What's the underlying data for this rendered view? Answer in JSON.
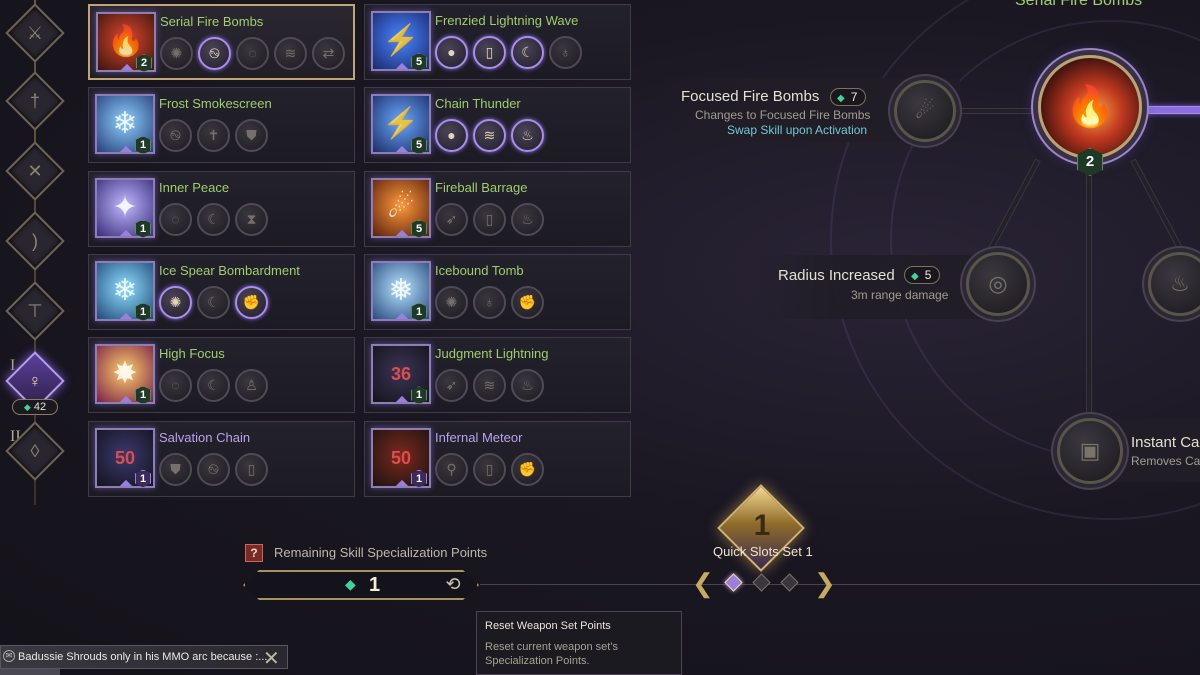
{
  "rail": {
    "roman_1": "I",
    "roman_2": "II",
    "points": "42",
    "nodes": [
      "sword-icon",
      "greatsword-icon",
      "crossed-swords-icon",
      "bow-icon",
      "crossbow-icon",
      "staff-icon",
      "wand-icon"
    ]
  },
  "skills": [
    {
      "name": "Serial Fire Bombs",
      "level": "2",
      "glyph": "🔥",
      "color_from": "#e0462c",
      "color_to": "#3a1610",
      "selected": true
    },
    {
      "name": "Frenzied Lightning Wave",
      "level": "5",
      "glyph": "⚡",
      "color_from": "#4a86ff",
      "color_to": "#1a2a70"
    },
    {
      "name": "Frost Smokescreen",
      "level": "1",
      "glyph": "❄",
      "color_from": "#8fd0ff",
      "color_to": "#263f7a"
    },
    {
      "name": "Chain Thunder",
      "level": "5",
      "glyph": "⚡",
      "color_from": "#6aa8ff",
      "color_to": "#1c2d66"
    },
    {
      "name": "Inner Peace",
      "level": "1",
      "glyph": "✦",
      "color_from": "#c0b8ff",
      "color_to": "#3a2d7a"
    },
    {
      "name": "Fireball Barrage",
      "level": "5",
      "glyph": "☄",
      "color_from": "#ff9a3a",
      "color_to": "#5a200e"
    },
    {
      "name": "Ice Spear Bombardment",
      "level": "1",
      "glyph": "❄",
      "color_from": "#8fe0ff",
      "color_to": "#204a7a"
    },
    {
      "name": "Icebound Tomb",
      "level": "1",
      "glyph": "❅",
      "color_from": "#b6e4ff",
      "color_to": "#2a4a80"
    },
    {
      "name": "High Focus",
      "level": "1",
      "glyph": "✸",
      "color_from": "#ffcf6a",
      "color_to": "#7a2048"
    },
    {
      "name": "Judgment Lightning",
      "level": "1",
      "glyph": "",
      "big_num": "36",
      "color_from": "#3a3556",
      "color_to": "#15131c"
    },
    {
      "name": "Salvation Chain",
      "level": "1",
      "glyph": "",
      "big_num": "50",
      "color_from": "#3a3a70",
      "color_to": "#15131c",
      "purple": true
    },
    {
      "name": "Infernal Meteor",
      "level": "1",
      "glyph": "",
      "big_num": "50",
      "color_from": "#7a2a1e",
      "color_to": "#1d1210",
      "purple": true
    }
  ],
  "modifiers": [
    [
      {
        "icon": "burst-icon",
        "on": false
      },
      {
        "icon": "swirl-icon",
        "on": true
      },
      {
        "icon": "ring-icon",
        "on": false
      },
      {
        "icon": "wave-icon",
        "on": false
      },
      {
        "icon": "swap-icon",
        "on": false
      }
    ],
    [
      {
        "icon": "bomb-icon",
        "on": true
      },
      {
        "icon": "scroll-icon",
        "on": true
      },
      {
        "icon": "crescent-icon",
        "on": true
      },
      {
        "icon": "pouch-icon",
        "on": false
      }
    ],
    [
      {
        "icon": "swirl-icon",
        "on": false
      },
      {
        "icon": "cross-icon",
        "on": false
      },
      {
        "icon": "shield-icon",
        "on": false
      }
    ],
    [
      {
        "icon": "bomb-icon",
        "on": true
      },
      {
        "icon": "wave-icon",
        "on": true
      },
      {
        "icon": "flame-icon",
        "on": true
      }
    ],
    [
      {
        "icon": "ring-icon",
        "on": false
      },
      {
        "icon": "crescent-icon",
        "on": false
      },
      {
        "icon": "timer-icon",
        "on": false
      }
    ],
    [
      {
        "icon": "arrow-icon",
        "on": false
      },
      {
        "icon": "scroll-icon",
        "on": false
      },
      {
        "icon": "flame-icon",
        "on": false
      }
    ],
    [
      {
        "icon": "burst-icon",
        "on": true
      },
      {
        "icon": "crescent-icon",
        "on": false
      },
      {
        "icon": "fist-icon",
        "on": true
      }
    ],
    [
      {
        "icon": "burst-icon",
        "on": false
      },
      {
        "icon": "pouch-icon",
        "on": false
      },
      {
        "icon": "fist-icon",
        "on": false
      }
    ],
    [
      {
        "icon": "ring-icon",
        "on": false
      },
      {
        "icon": "crescent-icon",
        "on": false
      },
      {
        "icon": "figure-icon",
        "on": false
      }
    ],
    [
      {
        "icon": "arrow-icon",
        "on": false
      },
      {
        "icon": "wave-icon",
        "on": false
      },
      {
        "icon": "flame-icon",
        "on": false
      }
    ],
    [
      {
        "icon": "shield-icon",
        "on": false
      },
      {
        "icon": "swirl-icon",
        "on": false
      },
      {
        "icon": "scroll-icon",
        "on": false
      }
    ],
    [
      {
        "icon": "pin-icon",
        "on": false
      },
      {
        "icon": "scroll-icon",
        "on": false
      },
      {
        "icon": "fist-icon",
        "on": false
      }
    ]
  ],
  "tree": {
    "title": "Serial Fire Bombs",
    "main_level": "2",
    "focused": {
      "name": "Focused Fire Bombs",
      "cost": "7",
      "desc": "Changes to Focused Fire Bombs",
      "highlight": "Swap Skill upon Activation"
    },
    "radius": {
      "name": "Radius Increased",
      "cost": "5",
      "desc": "3m range damage"
    },
    "instant": {
      "name": "Instant Ca",
      "desc": "Removes Ca"
    }
  },
  "bottom": {
    "help": "?",
    "remaining_label": "Remaining Skill Specialization Points",
    "remaining_points": "1",
    "reset_icon": "⟲",
    "quick_slot_number": "1",
    "quick_slot_label": "Quick Slots Set 1",
    "tooltip_title": "Reset Weapon Set Points",
    "tooltip_body": "Reset current weapon set's Specialization Points."
  },
  "chat": {
    "text": "Badussie  Shrouds only in his MMO arc because :..."
  }
}
